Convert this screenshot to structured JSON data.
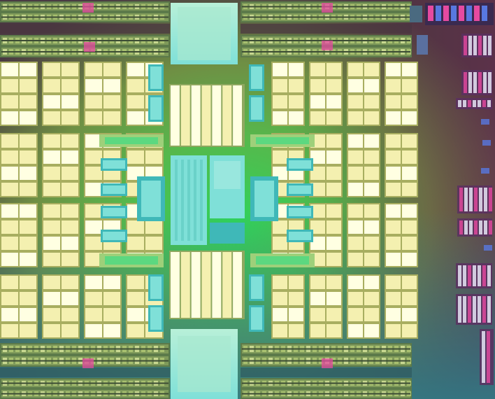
{
  "image": {
    "kind": "die-shot",
    "palette": {
      "edge_top": "#4a3a42",
      "edge_top_right": "#5a2838",
      "center_glow": "#2fd45a",
      "mid_green": "#6fa84a",
      "bottom_teal": "#2f7f8a",
      "cache_cell": "#f4f0b0",
      "cache_cell_hi": "#ffffe2",
      "cache_gap": "#a8ae60",
      "cyan_block": "#7fe0d8",
      "cyan_block_dark": "#3fb8b8",
      "bus_strip": "#9ed07a",
      "logic_pink": "#e64aa0",
      "logic_blue": "#5878e0",
      "logic_white": "#f0f0ff"
    }
  }
}
